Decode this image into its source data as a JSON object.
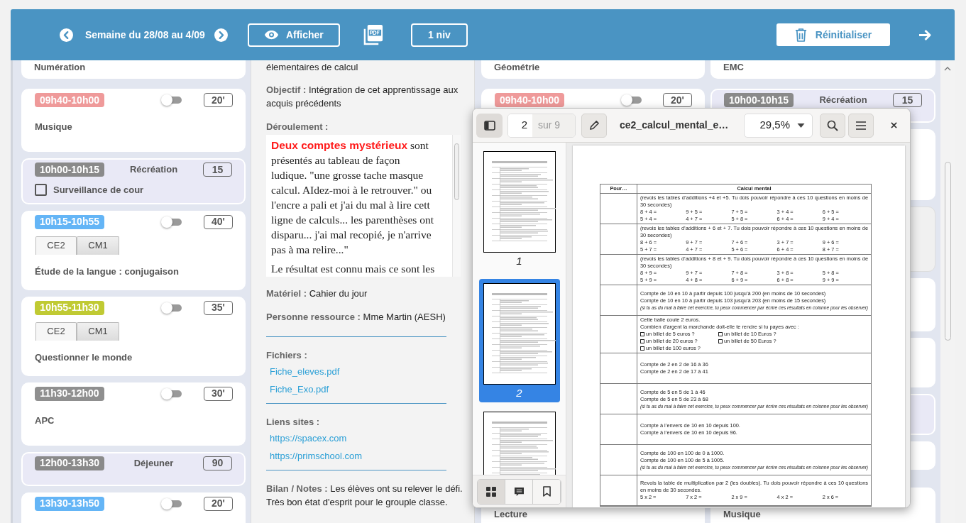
{
  "header": {
    "week": "Semaine du 28/08 au 4/09",
    "show_button": "Afficher",
    "level_button": "1 niv",
    "reset_button": "Réinitialiser"
  },
  "day_1": {
    "cards": [
      {
        "kind": "tail",
        "subject": "Numération"
      },
      {
        "kind": "lesson",
        "time": "09h40-10h00",
        "color": "#ef9a9a",
        "on": false,
        "duration": "20'",
        "subject": "Musique"
      },
      {
        "kind": "break",
        "time": "10h00-10h15",
        "label": "Récréation",
        "duration": "15",
        "task": {
          "label": "Surveillance de cour",
          "checked": false
        }
      },
      {
        "kind": "lesson",
        "time": "10h15-10h55",
        "color": "#64b5f6",
        "on": false,
        "duration": "40'",
        "levels": [
          {
            "label": "CE2",
            "selected": true
          },
          {
            "label": "CM1",
            "selected": false
          }
        ],
        "subject": "Étude de la langue : conjugaison"
      },
      {
        "kind": "lesson",
        "time": "10h55-11h30",
        "color": "#c0ca33",
        "on": false,
        "duration": "35'",
        "levels": [
          {
            "label": "CE2",
            "selected": true
          },
          {
            "label": "CM1",
            "selected": false
          }
        ],
        "subject": "Questionner le monde"
      },
      {
        "kind": "lesson",
        "time": "11h30-12h00",
        "color": "#8f8f8f",
        "on": false,
        "duration": "30'",
        "subject": "APC"
      },
      {
        "kind": "break",
        "time": "12h00-13h30",
        "label": "Déjeuner",
        "duration": "90"
      },
      {
        "kind": "lesson",
        "time": "13h30-13h50",
        "color": "#64b5f6",
        "on": false,
        "duration": "20'"
      }
    ]
  },
  "lesson_detail": {
    "sections": [
      {
        "kind": "text",
        "text": "élementaires de calcul"
      },
      {
        "kind": "field",
        "label": "Objectif :",
        "value": "Intégration de cet apprentissage aux acquis précédents"
      },
      {
        "kind": "richbox",
        "label": "Déroulement :",
        "paragraphs": [
          [
            "**Deux comptes mystérieux** sont",
            "présentés au tableau de façon",
            "ludique. \"une grosse tache masque",
            "calcul. AIdez-moi à le retrouver.\" ou",
            "l'encre a pali et j'ai du mal à lire cett",
            "ligne de calculs... les parenthèses ont",
            "disparu... j'ai mal recopié, je n'arrive",
            "pas à ma relire...\""
          ],
          [
            "Le résultat est connu mais ce sont les"
          ]
        ]
      },
      {
        "kind": "field",
        "label": "Matériel :",
        "value": "Cahier du jour"
      },
      {
        "kind": "field",
        "label": "Personne ressource :",
        "value": "Mme Martin (AESH)"
      },
      {
        "kind": "links",
        "label": "Fichiers :",
        "links": [
          "Fiche_eleves.pdf",
          "Fiche_Exo.pdf"
        ]
      },
      {
        "kind": "links",
        "label": "Liens sites :",
        "links": [
          "https://spacex.com",
          "https://primschool.com"
        ]
      },
      {
        "kind": "notes",
        "label": "Bilan / Notes :",
        "value": "Les élèves ont  su relever le défi. Très bon état d'esprit pour le grouple classe."
      }
    ]
  },
  "day_3": {
    "cards": [
      {
        "kind": "tail",
        "subject": "Géométrie"
      },
      {
        "kind": "lesson",
        "time": "09h40-10h00",
        "color": "#ef9a9a",
        "on": false,
        "duration": "20'"
      },
      {
        "kind": "bottom",
        "subject": "Lecture"
      }
    ]
  },
  "day_4": {
    "cards": [
      {
        "kind": "tail",
        "subject": "EMC"
      },
      {
        "kind": "break",
        "time": "10h00-10h15",
        "label": "Récréation",
        "duration": "15"
      },
      {
        "kind": "bottom",
        "subject": "Musique"
      }
    ]
  },
  "pdf_viewer": {
    "sidebar_toggle": {
      "selected": true
    },
    "page": "2",
    "page_count": "sur 9",
    "title": "ce2_calcul_mental_e…",
    "zoom": "29,5%",
    "thumbnails": [
      {
        "label": "1",
        "selected": false
      },
      {
        "label": "2",
        "selected": true
      },
      {
        "selected": false
      }
    ],
    "sidebar_tabs": [
      {
        "kind": "thumbnails",
        "selected": true
      },
      {
        "kind": "annotations",
        "selected": false
      },
      {
        "kind": "bookmarks",
        "selected": false
      }
    ],
    "document": {
      "header": [
        "Pour…",
        "Calcul mental"
      ],
      "rows": [
        [
          {
            "kind": "text",
            "text": "(revois les tables d’additions +4 et +5. Tu dois pouvoir répondre à ces 10 questions en moins de 30 secondes)"
          },
          {
            "kind": "grid",
            "cells": [
              "8 + 4 =",
              "9 + 5 =",
              "7 + 5 =",
              "3 + 4 =",
              "6 + 5 ="
            ]
          },
          {
            "kind": "grid",
            "cells": [
              "5 + 4 =",
              "4 + 7 =",
              "5 + 8 =",
              "6 + 4 =",
              "9 + 4 ="
            ]
          }
        ],
        [
          {
            "kind": "text",
            "text": "(revois les tables d’additions + 6 et + 7. Tu dois pouvoir répondre à ces 10 questions en moins de 30 secondes)"
          },
          {
            "kind": "grid",
            "cells": [
              "8 + 6 =",
              "9 + 7 =",
              "7 + 6 =",
              "3 + 7 =",
              "9 + 6 ="
            ]
          },
          {
            "kind": "grid",
            "cells": [
              "5 + 7 =",
              "4 + 7 =",
              "5 + 6 =",
              "6 + 4 =",
              "8 + 7 ="
            ]
          }
        ],
        [
          {
            "kind": "text",
            "text": "(revois les tables d’additions + 8 et + 9. Tu dois pouvoir répondre à ces 10 questions en moins de 30 secondes)"
          },
          {
            "kind": "grid",
            "cells": [
              "8 + 9 =",
              "9 + 7 =",
              "7 + 8 =",
              "3 + 8 =",
              "5 + 8 ="
            ]
          },
          {
            "kind": "grid",
            "cells": [
              "5 + 9 =",
              "4 + 8 =",
              "6 + 9 =",
              "6 + 8 =",
              "9 + 9 ="
            ]
          }
        ],
        [
          {
            "kind": "text",
            "text": "Compte de 10 en 10 à partir depuis 100 jusqu’à 200 (en moins de 10 secondes)"
          },
          {
            "kind": "text",
            "text": "Compte de 10 en 10 à partir depuis 103 jusqu’à 203 (en moins de 15 secondes)"
          },
          {
            "kind": "note",
            "text": "(si tu as du mal à faire cet exercice, tu peux commencer par écrire ces résultats en colonne pour les observer)"
          }
        ],
        [
          {
            "kind": "text",
            "text": "Cette balle coute 2 euros."
          },
          {
            "kind": "text",
            "text": "Combien d’argent la marchande doit-elle te rendre si tu payes avec :"
          },
          {
            "kind": "checks",
            "cells": [
              "un billet de 5 euros ?",
              "un billet de 10 Euros ?"
            ]
          },
          {
            "kind": "checks",
            "cells": [
              "un billet de 20 euros ?",
              "un billet de 50 Euros ?"
            ]
          },
          {
            "kind": "checks",
            "cells": [
              "un billet de 100 euros ?"
            ]
          }
        ],
        [
          {
            "kind": "text",
            "text": "Compte de 2 en 2 de 16 à 36"
          },
          {
            "kind": "text",
            "text": "Compte de 2 en 2 de 17 à 41"
          }
        ],
        [
          {
            "kind": "text",
            "text": "Compte de 5 en 5 de 1 à 46"
          },
          {
            "kind": "text",
            "text": "Compte de 5 en 5 de 23 à 68"
          },
          {
            "kind": "note",
            "text": "(si tu as du mal à faire cet exercice, tu peux commencer par écrire ces résultats en colonne pour les observer)"
          }
        ],
        [
          {
            "kind": "text",
            "text": "Compte à l’envers de 10 en 10 depuis 100."
          },
          {
            "kind": "text",
            "text": "Compte à l’envers de 10 en 10 depuis 96."
          }
        ],
        [
          {
            "kind": "text",
            "text": "Compte de 100 en 100 de 0 à 1000."
          },
          {
            "kind": "text",
            "text": "Compte de 100 en 100 de 5 à 1005."
          },
          {
            "kind": "note",
            "text": "(si tu as du mal à faire cet exercice, tu peux commencer par écrire ces résultats en colonne pour les observer)"
          }
        ],
        [
          {
            "kind": "text",
            "text": "Revois la table de multiplication par 2 (les doubles). Tu dois pouvoir répondre à ces 10 questions en moins de 30 secondes."
          },
          {
            "kind": "grid",
            "cells": [
              "5 x 2 =",
              "7 x 2 =",
              "2 x 9 =",
              "4 x 2 =",
              "2 x 6 ="
            ]
          }
        ]
      ]
    }
  }
}
